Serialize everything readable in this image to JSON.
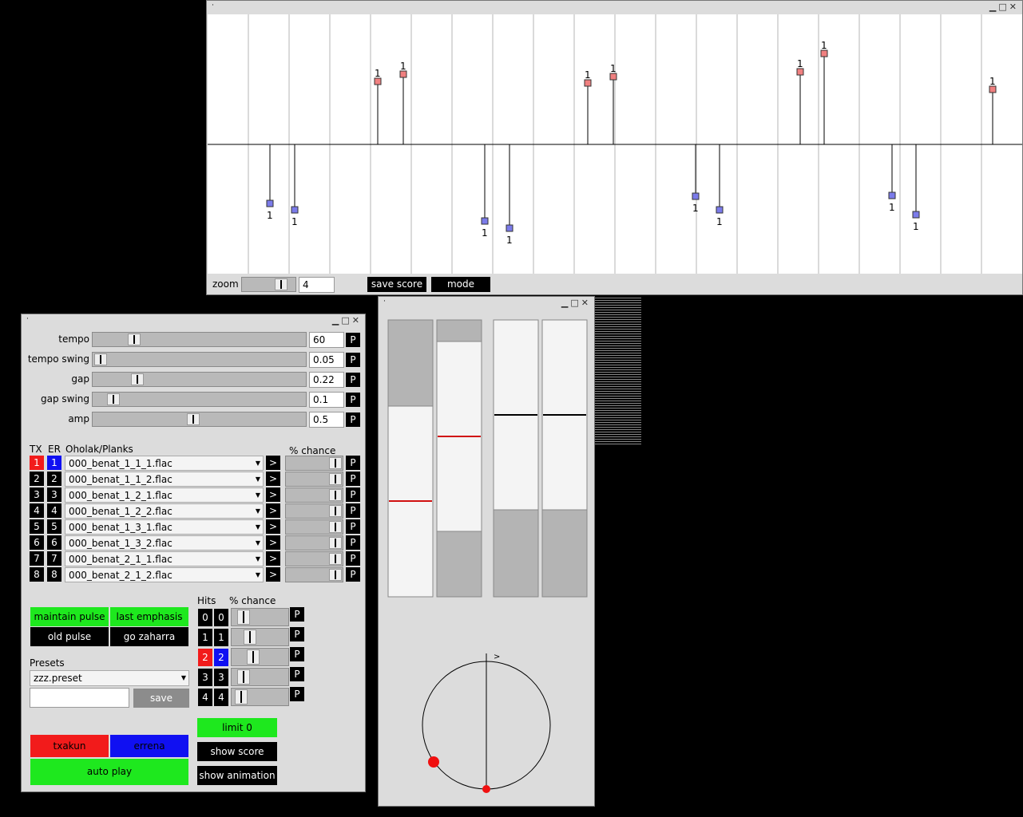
{
  "score_window": {
    "zoom_label": "zoom",
    "zoom_value": "4",
    "save_score_label": "save score",
    "mode_label": "mode",
    "note_label": "1",
    "txakun_color": "#f08080",
    "errena_color": "#7b7bea"
  },
  "main_window": {
    "params": [
      {
        "label": "tempo",
        "value": "60",
        "p": "P"
      },
      {
        "label": "tempo swing",
        "value": "0.05",
        "p": "P"
      },
      {
        "label": "gap",
        "value": "0.22",
        "p": "P"
      },
      {
        "label": "gap swing",
        "value": "0.1",
        "p": "P"
      },
      {
        "label": "amp",
        "value": "0.5",
        "p": "P"
      }
    ],
    "planks_headers": {
      "tx": "TX",
      "er": "ER",
      "planks": "Oholak/Planks",
      "chance": "% chance"
    },
    "planks": [
      {
        "tx": "1",
        "er": "1",
        "file": "000_benat_1_1_1.flac",
        "go": ">",
        "p": "P"
      },
      {
        "tx": "2",
        "er": "2",
        "file": "000_benat_1_1_2.flac",
        "go": ">",
        "p": "P"
      },
      {
        "tx": "3",
        "er": "3",
        "file": "000_benat_1_2_1.flac",
        "go": ">",
        "p": "P"
      },
      {
        "tx": "4",
        "er": "4",
        "file": "000_benat_1_2_2.flac",
        "go": ">",
        "p": "P"
      },
      {
        "tx": "5",
        "er": "5",
        "file": "000_benat_1_3_1.flac",
        "go": ">",
        "p": "P"
      },
      {
        "tx": "6",
        "er": "6",
        "file": "000_benat_1_3_2.flac",
        "go": ">",
        "p": "P"
      },
      {
        "tx": "7",
        "er": "7",
        "file": "000_benat_2_1_1.flac",
        "go": ">",
        "p": "P"
      },
      {
        "tx": "8",
        "er": "8",
        "file": "000_benat_2_1_2.flac",
        "go": ">",
        "p": "P"
      }
    ],
    "mode_buttons": {
      "maintain_pulse": "maintain pulse",
      "last_emphasis": "last emphasis",
      "old_pulse": "old pulse",
      "go_zaharra": "go zaharra"
    },
    "presets": {
      "label": "Presets",
      "selected": "zzz.preset",
      "name_value": "",
      "save": "save"
    },
    "hits_headers": {
      "hits": "Hits",
      "chance": "% chance"
    },
    "hits": [
      {
        "tx": "0",
        "er": "0",
        "p": "P"
      },
      {
        "tx": "1",
        "er": "1",
        "p": "P"
      },
      {
        "tx": "2",
        "er": "2",
        "p": "P"
      },
      {
        "tx": "3",
        "er": "3",
        "p": "P"
      },
      {
        "tx": "4",
        "er": "4",
        "p": "P"
      }
    ],
    "limit": "limit 0",
    "show_score": "show score",
    "show_animation": "show animation",
    "txakun": "txakun",
    "errena": "errena",
    "auto_play": "auto play"
  },
  "anim_window": {
    "pointer_glyph": ">"
  }
}
